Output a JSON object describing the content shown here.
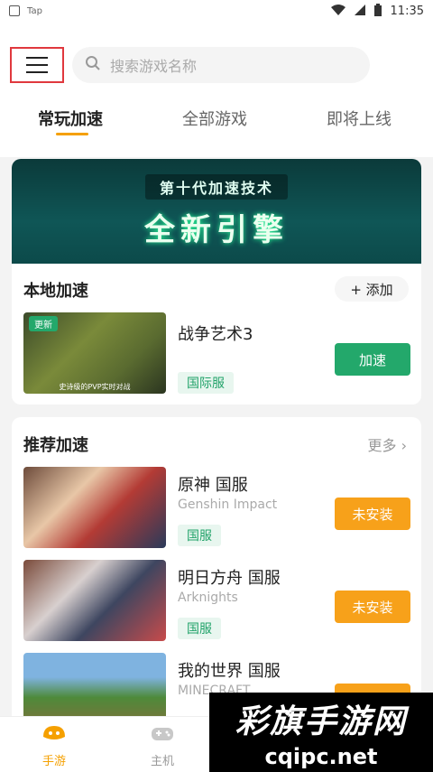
{
  "status_bar": {
    "app_label": "Tap",
    "time": "11:35"
  },
  "header": {
    "search_placeholder": "搜索游戏名称",
    "tabs": [
      {
        "label": "常玩加速",
        "active": true
      },
      {
        "label": "全部游戏",
        "active": false
      },
      {
        "label": "即将上线",
        "active": false
      }
    ]
  },
  "banner": {
    "subtitle": "第十代加速技术",
    "title": "全新引擎"
  },
  "local": {
    "title": "本地加速",
    "add_label": "+ 添加",
    "game": {
      "name": "战争艺术3",
      "badge": "更新",
      "caption": "史诗级的PVP实时对战",
      "tag": "国际服",
      "action": "加速"
    }
  },
  "recommend": {
    "title": "推荐加速",
    "more_label": "更多",
    "games": [
      {
        "name": "原神 国服",
        "subtitle": "Genshin Impact",
        "tag": "国服",
        "action": "未安装"
      },
      {
        "name": "明日方舟 国服",
        "subtitle": "Arknights",
        "tag": "国服",
        "action": "未安装"
      },
      {
        "name": "我的世界 国服",
        "subtitle": "MINECRAFT",
        "tag": "",
        "action": "未安装"
      }
    ]
  },
  "bottom_nav": {
    "items": [
      {
        "label": "手游",
        "active": true
      },
      {
        "label": "主机",
        "active": false
      }
    ]
  },
  "watermark": {
    "text_cn": "彩旗手游网",
    "text_en": "cqipc.net"
  },
  "colors": {
    "accent": "#f5a000",
    "green": "#23a86b",
    "orange": "#f7a11a"
  }
}
